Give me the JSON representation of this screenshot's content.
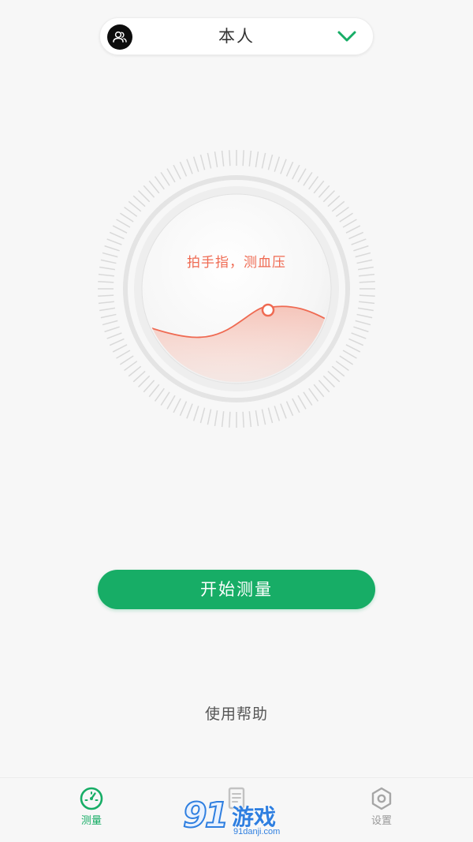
{
  "profile": {
    "name": "本人",
    "avatar_icon": "users-icon",
    "dropdown_icon": "chevron-down-icon"
  },
  "dial": {
    "prompt": "拍手指，测血压"
  },
  "actions": {
    "start_label": "开始测量",
    "help_label": "使用帮助"
  },
  "nav": {
    "items": [
      {
        "label": "测量",
        "icon": "speedometer-icon",
        "active": true
      },
      {
        "label": "",
        "icon": "document-icon",
        "active": false
      },
      {
        "label": "设置",
        "icon": "hexagon-gear-icon",
        "active": false
      }
    ]
  },
  "watermark": {
    "number": "91",
    "text": "游戏",
    "domain": "91danji.com"
  },
  "colors": {
    "accent_green": "#17ad66",
    "prompt_red": "#ef6a52",
    "background": "#f7f7f7"
  }
}
